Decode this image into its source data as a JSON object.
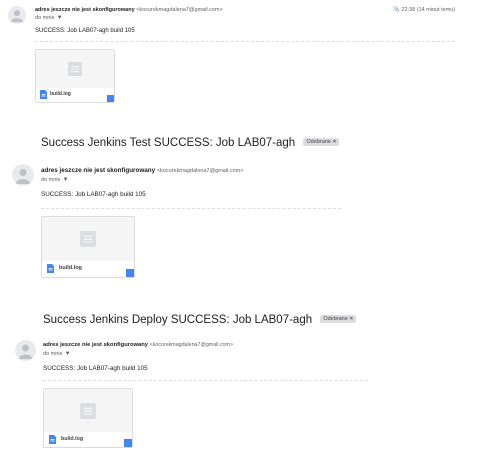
{
  "messages": [
    {
      "sender_name": "adres jeszcze nie jest skonfigurowany",
      "sender_email": "<kocurekmagdalena7@gmail.com>",
      "to": "do mnie",
      "time": "22:38 (14 minut temu)",
      "body": "SUCCESS: Job LAB07-agh build 105",
      "attachment": "build.log"
    },
    {
      "subject": "Success Jenkins Test SUCCESS: Job LAB07-agh",
      "label": "Odebrane",
      "sender_name": "adres jeszcze nie jest skonfigurowany",
      "sender_email": "<kocurekmagdalena7@gmail.com>",
      "to": "do mnie",
      "body": "SUCCESS: Job LAB07-agh build 105",
      "attachment": "build.log"
    },
    {
      "subject": "Success Jenkins Deploy SUCCESS: Job LAB07-agh",
      "label": "Odebrane",
      "sender_name": "adres jeszcze nie jest skonfigurowany",
      "sender_email": "<kocurekmagdalena7@gmail.com>",
      "to": "do mnie",
      "body": "SUCCESS: Job LAB07-agh build 105",
      "attachment": "build.log"
    }
  ],
  "icons": {
    "attachment_clip": "paperclip-icon",
    "avatar": "person-icon",
    "file": "google-docs-icon"
  }
}
